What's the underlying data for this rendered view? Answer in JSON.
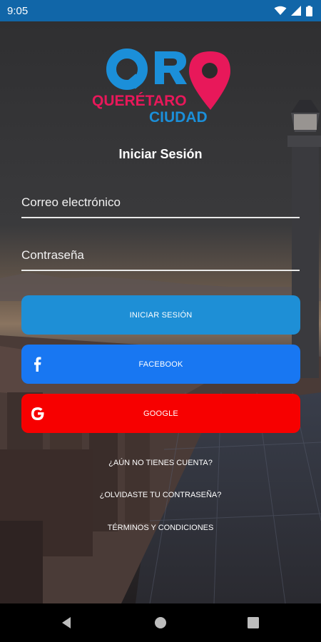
{
  "status_bar": {
    "time": "9:05",
    "icons": [
      "wifi-icon",
      "signal-icon",
      "battery-icon"
    ]
  },
  "logo": {
    "letters": "QRO",
    "line1": "QUERÉTARO",
    "line2": "CIUDAD"
  },
  "login": {
    "title": "Iniciar Sesión",
    "email_placeholder": "Correo electrónico",
    "password_placeholder": "Contraseña",
    "email_value": "",
    "password_value": "",
    "login_button": "INICIAR SESIÓN",
    "facebook_button": "FACEBOOK",
    "google_button": "GOOGLE"
  },
  "links": {
    "no_account": "¿AÚN NO TIENES CUENTA?",
    "forgot_password": "¿OLVIDASTE TU CONTRASEÑA?",
    "terms": "TÉRMINOS Y CONDICIONES"
  },
  "nav_bar": {
    "icons": [
      "back-icon",
      "home-icon",
      "recents-icon"
    ]
  },
  "colors": {
    "status_bar": "#1166a8",
    "login_button": "#1e8fd6",
    "facebook_button": "#1877f2",
    "google_button": "#f70000",
    "logo_blue": "#1b8fd9",
    "logo_pink": "#e8185a"
  }
}
